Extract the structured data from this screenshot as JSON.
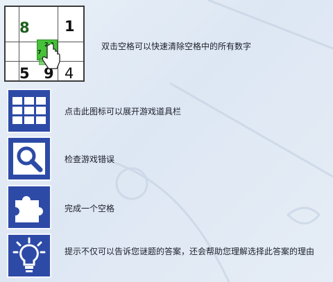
{
  "rows": [
    {
      "label": "双击空格可以快速清除空格中的所有数字",
      "icon": "sudoku-preview-icon"
    },
    {
      "label": "点击此图标可以展开游戏道具栏",
      "icon": "grid-icon"
    },
    {
      "label": "检查游戏错误",
      "icon": "magnifier-icon"
    },
    {
      "label": "完成一个空格",
      "icon": "puzzle-piece-icon"
    },
    {
      "label": "提示不仅可以告诉您谜题的答案，还会帮助您理解选择此答案的理由",
      "icon": "lightbulb-icon"
    }
  ],
  "sudoku": {
    "top_left": "8",
    "top_right": "1",
    "bottom_left": "5",
    "bottom_mid": "9",
    "bottom_right": "4",
    "notes": "2 3",
    "notes2": "7"
  },
  "colors": {
    "tile_blue": "#2d4aa6",
    "cell_green": "#46c13a"
  }
}
